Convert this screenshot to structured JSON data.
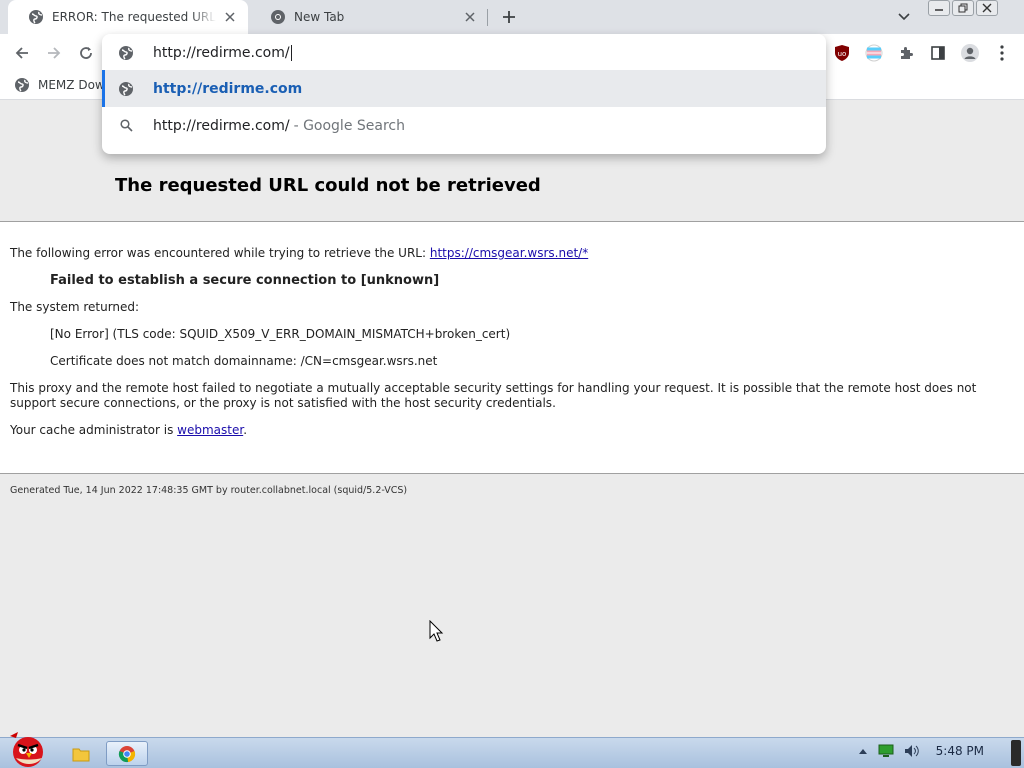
{
  "browser": {
    "tabs": [
      {
        "title": "ERROR: The requested URL could not be retrieved",
        "active": true
      },
      {
        "title": "New Tab",
        "active": false
      }
    ],
    "omnibox": {
      "input_value": "http://redirme.com/",
      "suggestions": [
        {
          "text": "http://redirme.com",
          "subtext": "",
          "icon": "globe-icon",
          "selected": true
        },
        {
          "text": "http://redirme.com/",
          "subtext": "- Google Search",
          "icon": "search-icon",
          "selected": false
        }
      ]
    },
    "bookmarks": [
      {
        "label": "MEMZ Dow"
      }
    ],
    "extensions": [
      "ublock-icon",
      "flag-extension-icon",
      "puzzle-icon",
      "sidepanel-icon",
      "profile-icon",
      "menu-icon"
    ]
  },
  "page": {
    "title": "The requested URL could not be retrieved",
    "intro_text": "The following error was encountered while trying to retrieve the URL: ",
    "intro_link": "https://cmsgear.wsrs.net/*",
    "error_heading": "Failed to establish a secure connection to [unknown]",
    "system_returned": "The system returned:",
    "error_code": "[No Error] (TLS code: SQUID_X509_V_ERR_DOMAIN_MISMATCH+broken_cert)",
    "cert_detail": "Certificate does not match domainname: /CN=cmsgear.wsrs.net",
    "explanation_line1": "This proxy and the remote host failed to negotiate a mutually acceptable security settings for handling your request. It is possible that the remote host does not",
    "explanation_line2": "support secure connections, or the proxy is not satisfied with the host security credentials.",
    "admin_text": "Your cache administrator is ",
    "admin_link": "webmaster",
    "admin_suffix": ".",
    "footer": "Generated Tue, 14 Jun 2022 17:48:35 GMT by router.collabnet.local (squid/5.2-VCS)"
  },
  "taskbar": {
    "clock": "5:48 PM"
  },
  "colors": {
    "accent": "#1a73e8",
    "link": "#1a0dab",
    "page_bg": "#ebebeb"
  }
}
